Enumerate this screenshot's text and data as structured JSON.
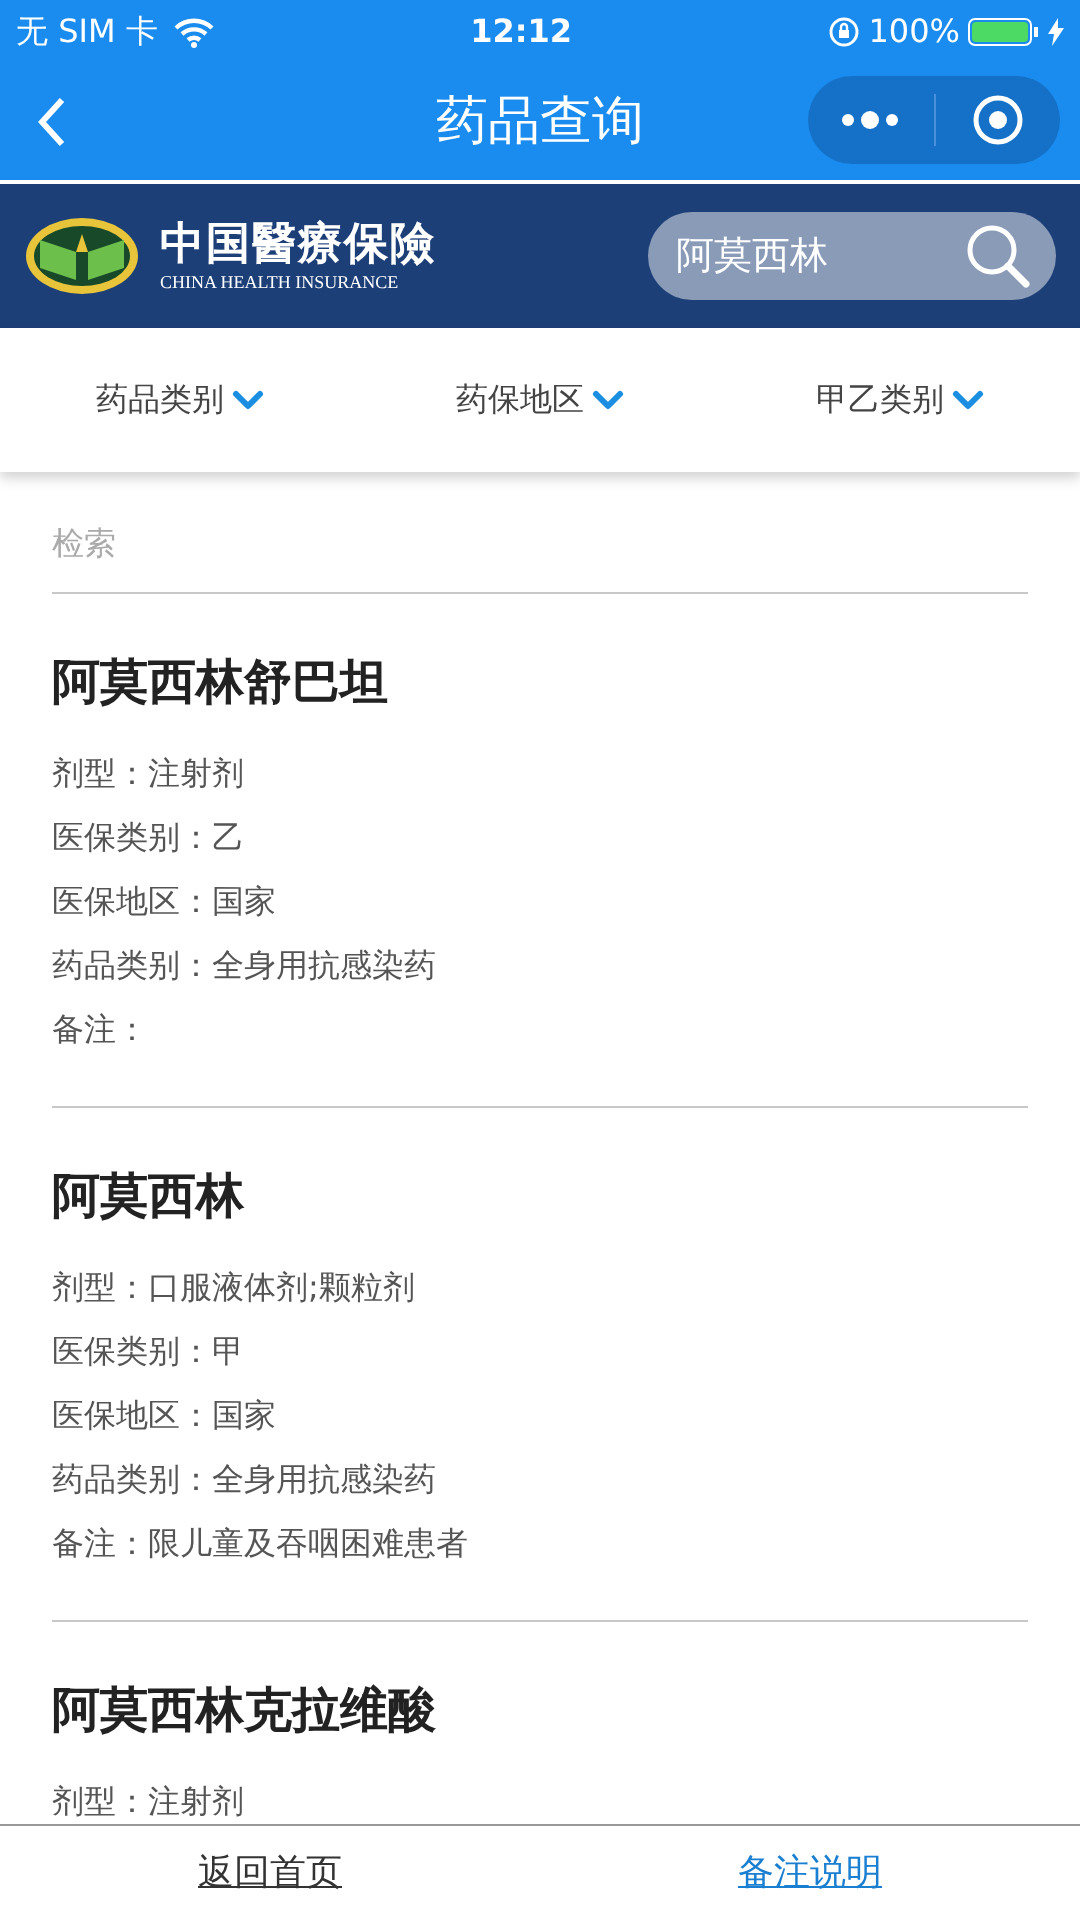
{
  "status_bar": {
    "carrier": "无 SIM 卡",
    "time": "12:12",
    "battery": "100%"
  },
  "nav": {
    "title": "药品查询"
  },
  "banner": {
    "logo_title": "中国醫療保險",
    "logo_subtitle": "CHINA HEALTH INSURANCE",
    "search_value": "阿莫西林"
  },
  "filters": [
    {
      "label": "药品类别"
    },
    {
      "label": "药保地区"
    },
    {
      "label": "甲乙类别"
    }
  ],
  "search_label": "检索",
  "results": [
    {
      "name": "阿莫西林舒巴坦",
      "fields": [
        "剂型：注射剂",
        "医保类别：乙",
        "医保地区：国家",
        "药品类别：全身用抗感染药",
        "备注："
      ]
    },
    {
      "name": "阿莫西林",
      "fields": [
        "剂型：口服液体剂;颗粒剂",
        "医保类别：甲",
        "医保地区：国家",
        "药品类别：全身用抗感染药",
        "备注：限儿童及吞咽困难患者"
      ]
    },
    {
      "name": "阿莫西林克拉维酸",
      "fields": [
        "剂型：注射剂"
      ]
    }
  ],
  "bottom_bar": [
    {
      "label": "返回首页"
    },
    {
      "label": "备注说明"
    }
  ]
}
